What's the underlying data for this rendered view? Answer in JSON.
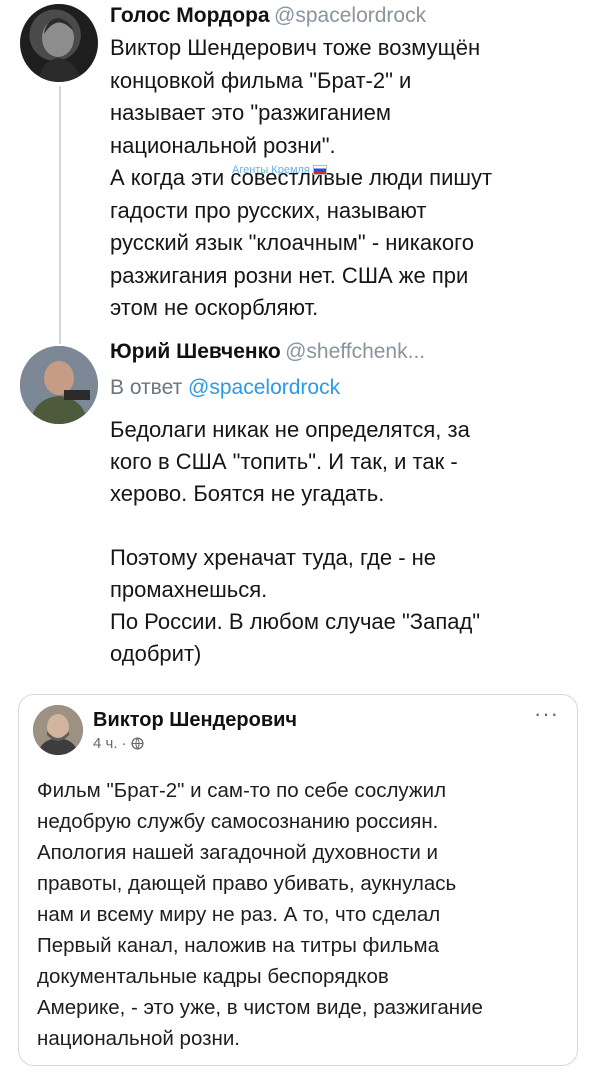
{
  "tweets": [
    {
      "name": "Голос Мордора",
      "handle": "@spacelordrock",
      "text": "Виктор Шендерович тоже возмущён\nконцовкой фильма \"Брат-2\" и\nназывает это \"разжиганием\nнациональной розни\".\nА когда эти совестливые люди пишут\nгадости про русских, называют\nрусский язык \"клоачным\" - никакого\nразжигания розни нет. США же при\nэтом не оскорбляют."
    },
    {
      "name": "Юрий Шевченко",
      "handle": "@sheffchenk...",
      "reply_prefix": "В ответ",
      "reply_handle": "@spacelordrock",
      "text": "Бедолаги никак не определятся, за\nкого в США \"топить\". И так, и так -\nхерово. Боятся не угадать.\n\nПоэтому хреначат туда, где - не\nпромахнешься.\nПо России. В любом случае \"Запад\"\nодобрит)"
    }
  ],
  "watermark": "Агенты Кремля",
  "facebook_post": {
    "name": "Виктор Шендерович",
    "meta": "4 ч. · ",
    "menu": "···",
    "text": "Фильм \"Брат-2\" и сам-то по себе сослужил\nнедобрую службу самосознанию россиян.\nАпология нашей загадочной духовности и\nправоты, дающей право убивать, аукнулась\nнам и всему миру не раз. А то, что сделал\nПервый канал, наложив на титры фильма\nдокументальные кадры беспорядков\nАмерике, - это уже, в чистом виде, разжигание\nнациональной розни."
  },
  "icons": {
    "flag": "russian-flag-icon",
    "privacy": "globe-icon"
  }
}
